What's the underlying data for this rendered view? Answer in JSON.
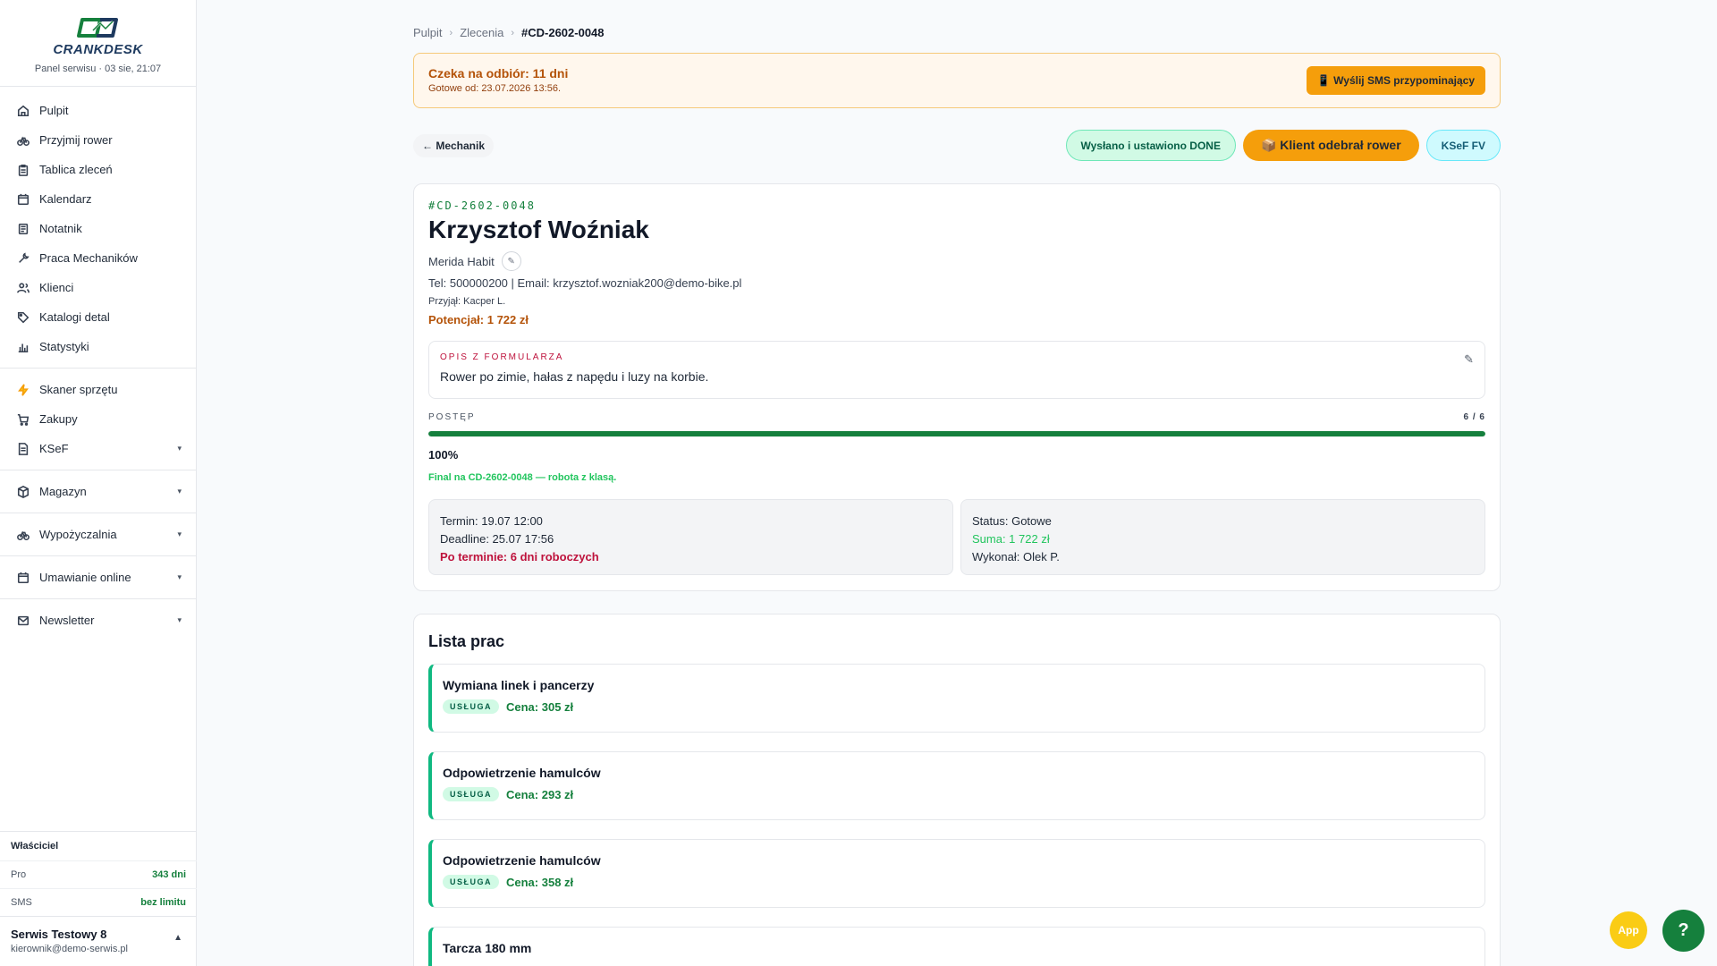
{
  "brand": {
    "name": "CRANKDESK",
    "subtitle": "Panel serwisu · 03 sie, 21:07",
    "accent": "#15803d"
  },
  "sidebar": {
    "items": [
      {
        "label": "Pulpit",
        "icon": "home-icon"
      },
      {
        "label": "Przyjmij rower",
        "icon": "bike-icon"
      },
      {
        "label": "Tablica zleceń",
        "icon": "clipboard-icon"
      },
      {
        "label": "Kalendarz",
        "icon": "calendar-icon"
      },
      {
        "label": "Notatnik",
        "icon": "notebook-icon"
      },
      {
        "label": "Praca Mechaników",
        "icon": "wrench-icon"
      },
      {
        "label": "Klienci",
        "icon": "users-icon"
      },
      {
        "label": "Katalogi detal",
        "icon": "tag-icon"
      },
      {
        "label": "Statystyki",
        "icon": "bar-chart-icon"
      }
    ],
    "tools": [
      {
        "label": "Skaner sprzętu",
        "icon": "lightning-icon"
      },
      {
        "label": "Zakupy",
        "icon": "cart-icon"
      },
      {
        "label": "KSeF",
        "icon": "document-icon",
        "caret": "▾"
      }
    ],
    "groups": [
      {
        "label": "Magazyn",
        "icon": "box-icon",
        "caret": "▾"
      },
      {
        "label": "Wypożyczalnia",
        "icon": "bike-icon",
        "caret": "▾"
      },
      {
        "label": "Umawianie online",
        "icon": "calendar-icon",
        "caret": "▾"
      },
      {
        "label": "Newsletter",
        "icon": "mail-icon",
        "caret": "▾"
      }
    ],
    "owner": {
      "title": "Właściciel",
      "rows": [
        {
          "label": "Pro",
          "value": "343 dni"
        },
        {
          "label": "SMS",
          "value": "bez limitu"
        }
      ],
      "account_name": "Serwis Testowy 8",
      "account_email": "kierownik@demo-serwis.pl",
      "chevron": "▲"
    }
  },
  "breadcrumb": {
    "items": [
      "Pulpit",
      "Zlecenia"
    ],
    "current": "#CD-2602-0048",
    "sep": "›"
  },
  "alert": {
    "title": "Czeka na odbiór: 11 dni",
    "subtitle": "Gotowe od: 23.07.2026 13:56.",
    "button": "📱 Wyślij SMS przypominający"
  },
  "toolbar": {
    "back": "← Mechanik",
    "sent_done": "Wysłano i ustawiono DONE",
    "picked_up": "📦 Klient odebrał rower",
    "ksef": "KSeF FV"
  },
  "order": {
    "code": "#CD-2602-0048",
    "customer": "Krzysztof Woźniak",
    "bike": "Merida Habit",
    "edit_glyph": "✎",
    "contact": "Tel: 500000200 | Email: krzysztof.wozniak200@demo-bike.pl",
    "received_by": "Przyjął: Kacper L.",
    "potential": "Potencjał: 1 722 zł",
    "form": {
      "label": "OPIS Z FORMULARZA",
      "text": "Rower po zimie, hałas z napędu i luzy na korbie.",
      "edit_glyph": "✎"
    },
    "progress": {
      "label": "POSTĘP",
      "count": "6 / 6",
      "value": 1.0,
      "percent": "100%",
      "note": "Final na CD-2602-0048 — robota z klasą."
    },
    "schedule": {
      "term": "Termin: 19.07 12:00",
      "deadline": "Deadline: 25.07 17:56",
      "overdue": "Po terminie: 6 dni roboczych"
    },
    "status": {
      "status": "Status: Gotowe",
      "sum": "Suma: 1 722 zł",
      "done_by": "Wykonał: Olek P."
    }
  },
  "jobs": {
    "title": "Lista prac",
    "items": [
      {
        "name": "Wymiana linek i pancerzy",
        "badge": "USŁUGA",
        "price": "Cena: 305 zł"
      },
      {
        "name": "Odpowietrzenie hamulców",
        "badge": "USŁUGA",
        "price": "Cena: 293 zł"
      },
      {
        "name": "Odpowietrzenie hamulców",
        "badge": "USŁUGA",
        "price": "Cena: 358 zł"
      },
      {
        "name": "Tarcza 180 mm",
        "badge": "",
        "price": ""
      }
    ]
  },
  "fab": {
    "app": "App",
    "help": "?"
  }
}
